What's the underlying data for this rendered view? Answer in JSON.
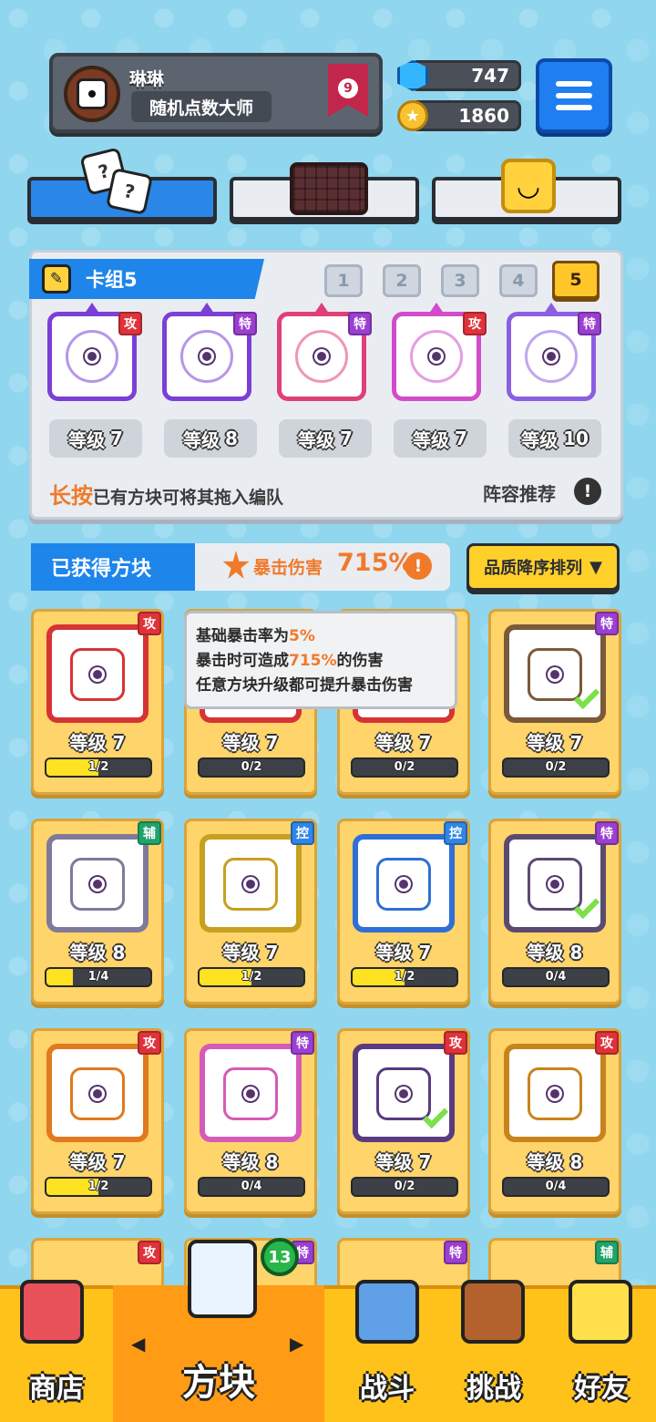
{
  "profile": {
    "name": "琳琳",
    "title": "随机点数大师",
    "rank": "9"
  },
  "currency": {
    "gems": "747",
    "coins": "1860"
  },
  "deck": {
    "title": "卡组5",
    "tabs": [
      "1",
      "2",
      "3",
      "4",
      "5"
    ],
    "active_tab": "5",
    "cards": [
      {
        "tag": "攻",
        "level_word": "等级",
        "level": "7",
        "color": "#7b3fd6"
      },
      {
        "tag": "特",
        "level_word": "等级",
        "level": "8",
        "color": "#7b3fd6"
      },
      {
        "tag": "特",
        "level_word": "等级",
        "level": "7",
        "color": "#e03f7a"
      },
      {
        "tag": "攻",
        "level_word": "等级",
        "level": "7",
        "color": "#d34bc9"
      },
      {
        "tag": "特",
        "level_word": "等级",
        "level": "10",
        "color": "#8b5fe0"
      }
    ],
    "hint_highlight": "长按",
    "hint_rest": "已有方块可将其拖入编队",
    "recommend": "阵容推荐"
  },
  "owned": {
    "header": "已获得方块",
    "crit_label": "暴击伤害",
    "crit_value": "715%",
    "sort_label": "品质降序排列",
    "cards": [
      {
        "tag": "攻",
        "tag_type": "atk",
        "level": "等级 7",
        "progress": "1/2",
        "fill": 0.5,
        "color": "#d63434"
      },
      {
        "tag": "",
        "tag_type": "",
        "level": "等级 7",
        "progress": "0/2",
        "fill": 0,
        "color": "#d63434"
      },
      {
        "tag": "",
        "tag_type": "",
        "level": "等级 7",
        "progress": "0/2",
        "fill": 0,
        "color": "#d63434"
      },
      {
        "tag": "特",
        "tag_type": "spc",
        "level": "等级 7",
        "progress": "0/2",
        "fill": 0,
        "color": "#7a5a3a"
      },
      {
        "tag": "辅",
        "tag_type": "sup",
        "level": "等级 8",
        "progress": "1/4",
        "fill": 0.25,
        "color": "#7f7a9a"
      },
      {
        "tag": "控",
        "tag_type": "ctl",
        "level": "等级 7",
        "progress": "1/2",
        "fill": 0.5,
        "color": "#c8a020"
      },
      {
        "tag": "控",
        "tag_type": "ctl",
        "level": "等级 7",
        "progress": "1/2",
        "fill": 0.5,
        "color": "#2f6fd6"
      },
      {
        "tag": "特",
        "tag_type": "spc",
        "level": "等级 8",
        "progress": "0/4",
        "fill": 0,
        "color": "#5b4a70"
      },
      {
        "tag": "攻",
        "tag_type": "atk",
        "level": "等级 7",
        "progress": "1/2",
        "fill": 0.5,
        "color": "#e0791f"
      },
      {
        "tag": "特",
        "tag_type": "spc",
        "level": "等级 8",
        "progress": "0/4",
        "fill": 0,
        "color": "#d55bb8"
      },
      {
        "tag": "攻",
        "tag_type": "atk",
        "level": "等级 7",
        "progress": "0/2",
        "fill": 0,
        "color": "#5a3a80"
      },
      {
        "tag": "攻",
        "tag_type": "atk",
        "level": "等级 8",
        "progress": "0/4",
        "fill": 0,
        "color": "#c8841c"
      }
    ],
    "partial_row_tags": [
      "攻",
      "特",
      "特",
      "辅"
    ]
  },
  "tooltip": {
    "line1_prefix": "基础暴击率为",
    "line1_value": "5%",
    "line2_prefix": "暴击时可造成",
    "line2_value": "715%",
    "line2_suffix": "的伤害",
    "line3": "任意方块升级都可提升暴击伤害"
  },
  "nav": {
    "shop": "商店",
    "blocks": "方块",
    "battle": "战斗",
    "challenge": "挑战",
    "friends": "好友",
    "blocks_badge": "13"
  }
}
